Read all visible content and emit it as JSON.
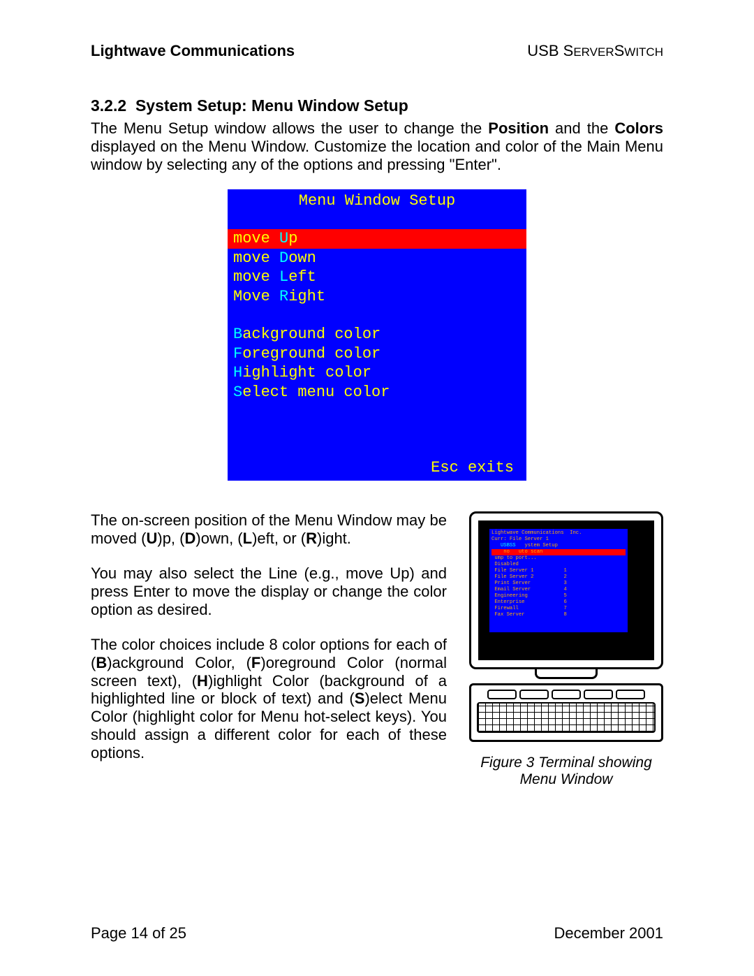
{
  "header": {
    "left": "Lightwave Communications",
    "right_prefix": "USB ",
    "right_word1": "S",
    "right_word1b": "ERVER",
    "right_word2": "S",
    "right_word2b": "WITCH"
  },
  "section": {
    "number": "3.2.2",
    "title": "System Setup: Menu Window Setup"
  },
  "intro": {
    "t1": "The Menu Setup window allows the user to change the ",
    "b1": "Position",
    "t2": " and the ",
    "b2": "Colors",
    "t3": " displayed on the Menu Window. Customize the location and color of the Main Menu window by selecting any of the options and pressing \"Enter\"."
  },
  "menu": {
    "title": "Menu Window Setup",
    "items": [
      {
        "pre": "move ",
        "hot": "U",
        "post": "p",
        "selected": true
      },
      {
        "pre": "move ",
        "hot": "D",
        "post": "own",
        "selected": false
      },
      {
        "pre": "move ",
        "hot": "L",
        "post": "eft",
        "selected": false
      },
      {
        "pre": "Move ",
        "hot": "R",
        "post": "ight",
        "selected": false
      }
    ],
    "items2": [
      {
        "pre": "",
        "hot": "B",
        "post": "ackground color"
      },
      {
        "pre": "",
        "hot": "F",
        "post": "oreground color"
      },
      {
        "pre": "",
        "hot": "H",
        "post": "ighlight color"
      },
      {
        "pre": "",
        "hot": "S",
        "post": "elect menu color"
      }
    ],
    "footer": "Esc exits"
  },
  "body": {
    "p1a": "The on-screen position of the Menu Window may be moved (",
    "p1b": "U",
    "p1c": ")p, (",
    "p1d": "D",
    "p1e": ")own, (",
    "p1f": "L",
    "p1g": ")eft, or (",
    "p1h": "R",
    "p1i": ")ight.",
    "p2": "You may also select the Line (e.g., move Up) and press Enter to move the display or change the color option as desired.",
    "p3a": "The color choices include 8 color options for each of (",
    "p3b": "B",
    "p3c": ")ackground Color, (",
    "p3d": "F",
    "p3e": ")oreground Color (normal screen text), (",
    "p3f": "H",
    "p3g": ")ighlight Color (background of a highlighted line or block of text) and (",
    "p3h": "S",
    "p3i": ")elect Menu Color (highlight color for Menu hot-select keys). You should assign a different color for each of these options."
  },
  "mini": {
    "l1": "Lightwave Communications  Inc.",
    "l2": "Curr: File Server 1",
    "l3a": "   USBSS   ",
    "l3b": "ystem Setup",
    "l4": "    no   uto scan",
    "l5": " ump to port...",
    "rows": [
      [
        "Disabled",
        ""
      ],
      [
        "File Server 1",
        "1"
      ],
      [
        "File Server 2",
        "2"
      ],
      [
        "Print Server",
        "3"
      ],
      [
        "Email Server",
        "4"
      ],
      [
        "Engineering",
        "5"
      ],
      [
        "Enterprise",
        "6"
      ],
      [
        "Firewall",
        "7"
      ],
      [
        "Fax Server",
        "8"
      ]
    ]
  },
  "figure_caption": "Figure 3  Terminal showing Menu Window",
  "footer": {
    "left": "Page 14 of 25",
    "right": "December 2001"
  }
}
